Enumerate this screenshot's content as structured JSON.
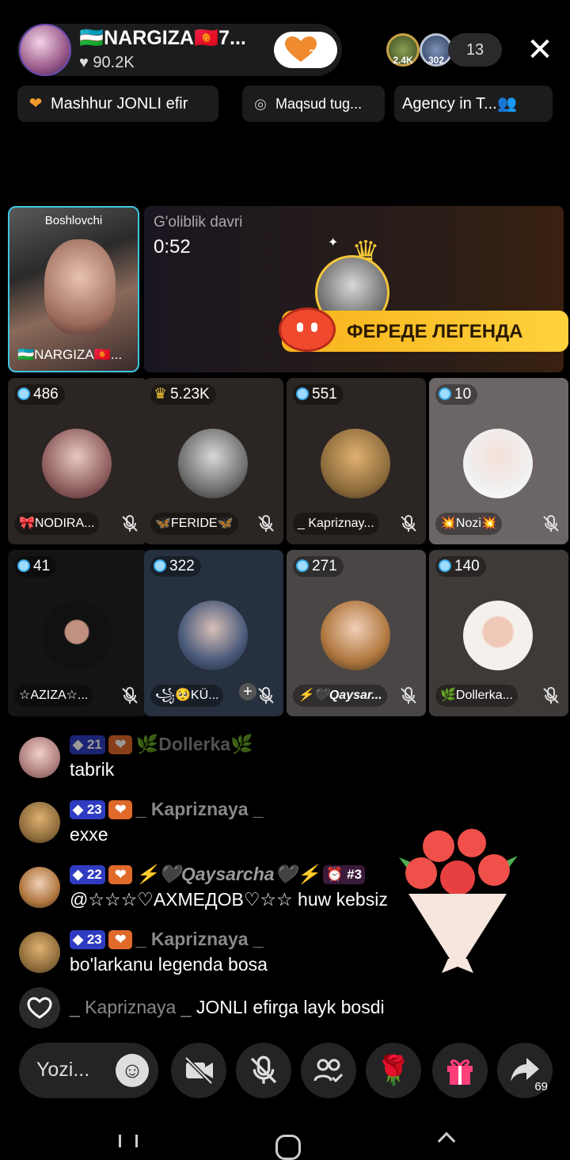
{
  "header": {
    "host_name": "🇺🇿NARGIZA🇰🇬7...",
    "host_likes": "♥ 90.2K",
    "follow_count": "21",
    "viewer_avatars": [
      "2.4K",
      "302"
    ],
    "viewer_count": "13",
    "close_glyph": "✕"
  },
  "chips": [
    {
      "label": "Mashhur JONLI efir",
      "icon": "heart-icon"
    },
    {
      "label": "Maqsud tug...",
      "icon": "target-icon"
    },
    {
      "label": "Agency in T...",
      "icon": "team-icon"
    }
  ],
  "host_tile": {
    "role": "Boshlovchi",
    "name": "🇺🇿NARGIZA🇰🇬..."
  },
  "battle": {
    "title": "G'oliblik davri",
    "timer": "0:52",
    "banner": "ФЕРЕДЕ ЛЕГЕНДА"
  },
  "guests": [
    {
      "score": "486",
      "name": "🎀NODIRA...",
      "crown": false
    },
    {
      "score": "5.23K",
      "name": "🦋FERIDE🦋",
      "crown": true
    },
    {
      "score": "551",
      "name": "_ Kapriznay...",
      "crown": false
    },
    {
      "score": "10",
      "name": "💥Nozi💥",
      "crown": false
    },
    {
      "score": "41",
      "name": "☆AZIZA☆...",
      "crown": false
    },
    {
      "score": "322",
      "name": "꧁🥺KÜ...",
      "crown": false
    },
    {
      "score": "271",
      "name": "⚡🖤Qaysar...",
      "crown": false
    },
    {
      "score": "140",
      "name": "🌿Dollerka...",
      "crown": false
    }
  ],
  "chat": [
    {
      "level": "21",
      "user": "🌿Dollerka🌿",
      "message": "tabrik"
    },
    {
      "level": "23",
      "user": "_ Kapriznaya _",
      "message": "exxe"
    },
    {
      "level": "22",
      "user": "⚡🖤Qaysarcha🖤⚡",
      "message": "@☆☆☆♡АХМЕДОВ♡☆☆ huw kebsiz",
      "extra": "⏰ #3"
    },
    {
      "level": "23",
      "user": "_ Kapriznaya _",
      "message": "bo'larkanu legenda bosa"
    }
  ],
  "like_notice": {
    "user": "_ Kapriznaya _",
    "text": " JONLI efirga layk bosdi"
  },
  "bottom_bar": {
    "comment_placeholder": "Yozi...",
    "share_count": "69"
  },
  "colors": {
    "accent_teal": "#3ec6e0",
    "gold": "#f3c637",
    "banner": "#ffd23d",
    "level_badge": "#2f3cc2",
    "fan_badge": "#e06a2a"
  }
}
